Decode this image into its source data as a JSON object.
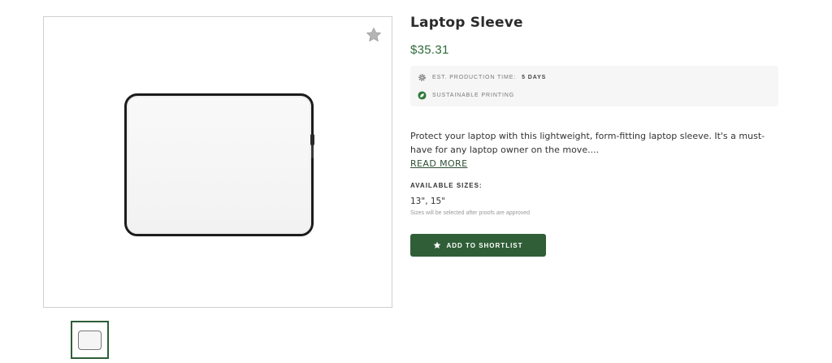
{
  "product": {
    "title": "Laptop Sleeve",
    "price": "$35.31",
    "image_alt_icon": "laptop-sleeve-image"
  },
  "info": {
    "production_label": "Est. production time:",
    "production_value": "5 days",
    "production_icon": "gear-icon",
    "sustainable_label": "Sustainable printing",
    "sustainable_icon": "leaf-icon"
  },
  "description": {
    "text": "Protect your laptop with this lightweight, form-fitting laptop sleeve. It's a must-have for any laptop owner on the move....",
    "read_more": "READ MORE"
  },
  "sizes": {
    "heading": "AVAILABLE SIZES:",
    "value": "13\", 15\"",
    "note": "Sizes will be selected after proofs are approved"
  },
  "actions": {
    "shortlist_label": "ADD TO SHORTLIST",
    "shortlist_icon": "star-icon",
    "favorite_icon": "star-icon"
  },
  "colors": {
    "brand_green": "#2f5e37",
    "price_green": "#2f6a3a",
    "info_bg": "#f6f6f6"
  }
}
